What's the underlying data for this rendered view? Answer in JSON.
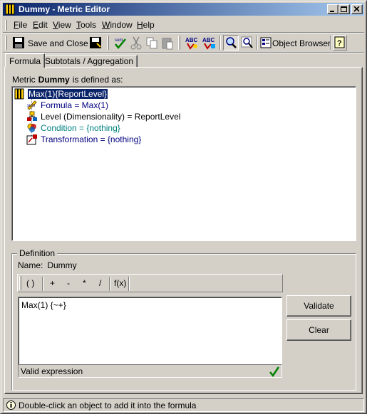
{
  "window": {
    "title": "Dummy - Metric Editor"
  },
  "menu": [
    {
      "label": "File"
    },
    {
      "label": "Edit"
    },
    {
      "label": "View"
    },
    {
      "label": "Tools"
    },
    {
      "label": "Window"
    },
    {
      "label": "Help"
    }
  ],
  "toolbar": {
    "save_close_label": "Save and Close",
    "object_browser_label": "Object Browser",
    "icons": [
      "save-icon",
      "save-as-icon",
      "sum-check-icon",
      "cut-icon",
      "copy-icon",
      "paste-icon",
      "abc-icon",
      "abc-check-icon",
      "zoom-icon",
      "zoom-grid-icon",
      "object-browser-icon",
      "help-icon"
    ]
  },
  "tabs": [
    {
      "label": "Formula",
      "active": true
    },
    {
      "label": "Subtotals / Aggregation",
      "active": false
    }
  ],
  "metric": {
    "prefix": "Metric",
    "name": "Dummy",
    "suffix": "is defined as:"
  },
  "tree": {
    "root": {
      "label": "Max(1){ReportLevel}",
      "icon": "metric-icon"
    },
    "children": [
      {
        "label": "Formula = Max(1)",
        "icon": "formula-icon",
        "color": "#000080"
      },
      {
        "label": "Level (Dimensionality) = ReportLevel",
        "icon": "level-icon",
        "color": "#000000"
      },
      {
        "label": "Condition = {nothing}",
        "icon": "condition-icon",
        "color": "#008080"
      },
      {
        "label": "Transformation = {nothing}",
        "icon": "transformation-icon",
        "color": "#000080"
      }
    ]
  },
  "definition": {
    "group_title": "Definition",
    "name_label": "Name:",
    "name_value": "Dummy",
    "operators": [
      "( )",
      "+",
      "-",
      "*",
      "/",
      "f(x)"
    ],
    "formula": "Max(1) {~+}",
    "status": "Valid expression",
    "validate_label": "Validate",
    "clear_label": "Clear"
  },
  "statusbar": {
    "text": "Double-click an object to add it into the formula"
  }
}
